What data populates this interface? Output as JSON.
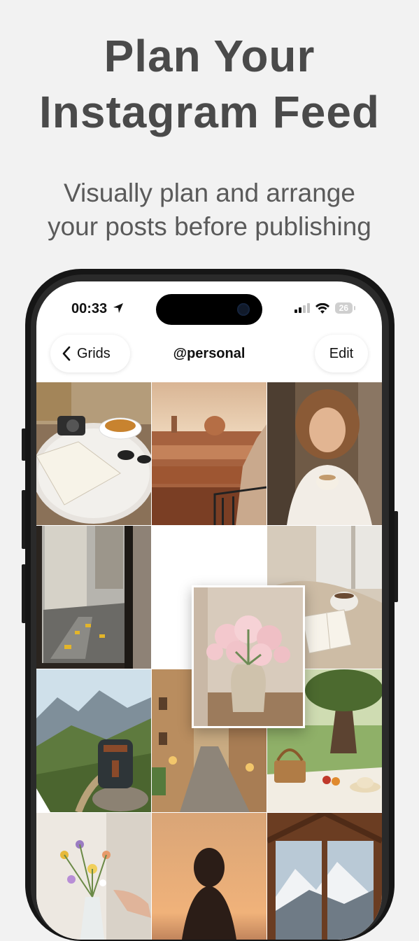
{
  "promo": {
    "headline_lines": [
      "Plan Your",
      "Instagram Feed"
    ],
    "subhead_lines": [
      "Visually plan and arrange",
      "your posts before publishing"
    ]
  },
  "status_bar": {
    "time": "00:33",
    "battery": "26",
    "icons": [
      "location-arrow-icon",
      "cellular-signal-icon",
      "wifi-icon",
      "battery-icon"
    ]
  },
  "nav": {
    "back_label": "Grids",
    "back_icon": "chevron-left-icon",
    "title": "@personal",
    "edit_label": "Edit"
  },
  "grid": {
    "tiles": [
      {
        "name": "cafe-table-photo"
      },
      {
        "name": "florence-rooftops-photo"
      },
      {
        "name": "laughing-woman-coffee-photo"
      },
      {
        "name": "city-street-window-photo"
      },
      {
        "name": "empty-slot"
      },
      {
        "name": "cozy-book-blanket-photo"
      },
      {
        "name": "mountain-backpack-photo"
      },
      {
        "name": "italian-alley-photo"
      },
      {
        "name": "picnic-basket-photo"
      },
      {
        "name": "flower-bouquet-photo"
      },
      {
        "name": "sunset-silhouette-photo"
      },
      {
        "name": "cabin-window-mountains-photo"
      }
    ],
    "dragging_tile": {
      "name": "peonies-vase-photo"
    }
  },
  "colors": {
    "background": "#f2f2f2",
    "headline": "#4a4a4a",
    "phone_body": "#161616"
  }
}
